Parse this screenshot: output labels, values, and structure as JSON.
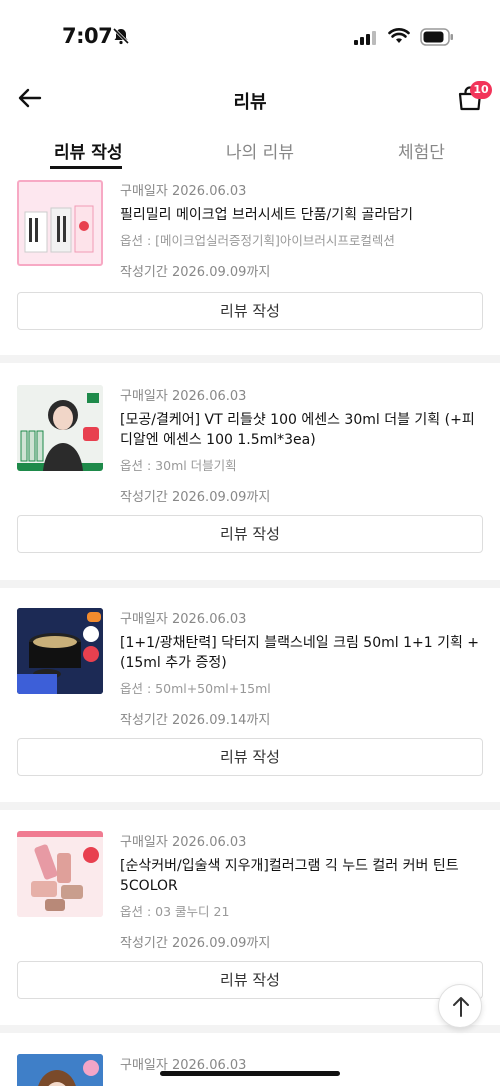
{
  "status_bar": {
    "time": "7:07"
  },
  "header": {
    "title": "리뷰",
    "cart_count": "10"
  },
  "tabs": [
    {
      "label": "리뷰 작성"
    },
    {
      "label": "나의 리뷰"
    },
    {
      "label": "체험단"
    }
  ],
  "items": [
    {
      "purchase_date": "구매일자 2026.06.03",
      "name": "필리밀리 메이크업 브러시세트 단품/기획 골라담기",
      "option": "옵션 : [메이크업실러증정기획]아이브러시프로컬렉션",
      "period": "작성기간 2026.09.09까지",
      "button": "리뷰 작성"
    },
    {
      "purchase_date": "구매일자 2026.06.03",
      "name": "[모공/결케어] VT 리들샷 100 에센스 30ml 더블 기획 (+피디알엔 에센스 100 1.5ml*3ea)",
      "option": "옵션 : 30ml 더블기획",
      "period": "작성기간 2026.09.09까지",
      "button": "리뷰 작성"
    },
    {
      "purchase_date": "구매일자 2026.06.03",
      "name": "[1+1/광채탄력] 닥터지 블랙스네일 크림 50ml 1+1 기획 +(15ml 추가 증정)",
      "option": "옵션 : 50ml+50ml+15ml",
      "period": "작성기간 2026.09.14까지",
      "button": "리뷰 작성"
    },
    {
      "purchase_date": "구매일자 2026.06.03",
      "name": "[순삭커버/입술색 지우개]컬러그램 긱 누드 컬러 커버 틴트 5COLOR",
      "option": "옵션 : 03 쿨누디 21",
      "period": "작성기간 2026.09.09까지",
      "button": "리뷰 작성"
    },
    {
      "purchase_date": "구매일자 2026.06.03",
      "name": "",
      "option": "",
      "period": "",
      "button": ""
    }
  ],
  "colors": {
    "accent": "#f2345a",
    "text": "#111111",
    "muted": "#888888"
  }
}
